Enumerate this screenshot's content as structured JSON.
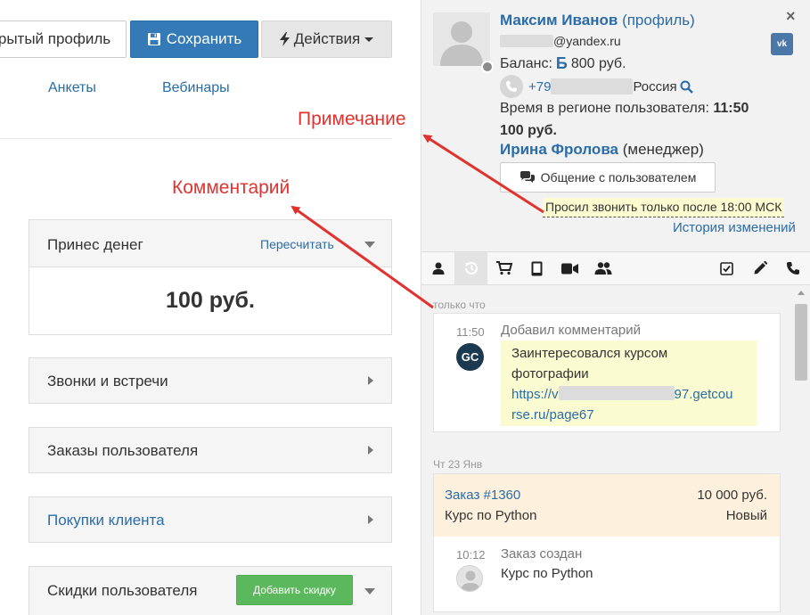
{
  "header": {
    "open_profile_label": "рытый профиль",
    "save_label": "Сохранить",
    "actions_label": "Действия"
  },
  "tabs": [
    "Анкеты",
    "Вебинары"
  ],
  "annotations": {
    "comment": "Комментарий",
    "note": "Примечание"
  },
  "panels": {
    "money": {
      "title": "Принес денег",
      "recalc": "Пересчитать",
      "amount": "100 руб."
    },
    "calls": {
      "title": "Звонки и встречи"
    },
    "orders": {
      "title": "Заказы пользователя"
    },
    "purchases": {
      "title": "Покупки клиента"
    },
    "discounts": {
      "title": "Скидки пользователя",
      "add_label": "Добавить скидку"
    }
  },
  "user": {
    "name": "Максим Иванов",
    "profile_link": "(профиль)",
    "email_domain": "@yandex.ru",
    "balance_label": "Баланс:",
    "balance_value": "800 руб.",
    "balance_icon": "Б",
    "phone_prefix": "+79",
    "phone_country": "Россия",
    "region_label": "Время в регионе пользователя:",
    "region_time": "11:50",
    "region_tail": "100 руб.",
    "manager_name": "Ирина Фролова",
    "manager_role": "(менеджер)",
    "chat_label": "Общение с пользователем",
    "note": "Просил звонить только после 18:00 МСК",
    "history_link": "История изменений",
    "vk_label": "vk",
    "close_glyph": "×"
  },
  "toolbar_icons": [
    "user-icon",
    "history-icon",
    "cart-icon",
    "tablet-icon",
    "video-icon",
    "group-icon",
    "checkbox-icon",
    "pencil-icon",
    "phone-icon"
  ],
  "feed": {
    "now_label": "только что",
    "comment": {
      "time": "11:50",
      "title": "Добавил комментарий",
      "text": "Заинтересовался курсом фотографии",
      "link_start": "https://v",
      "link_mid": "97.getcou",
      "link_end": "rse.ru/page67",
      "logo": "GC"
    },
    "date_label": "Чт 23 Янв",
    "order": {
      "number": "Заказ #1360",
      "sum": "10 000 руб.",
      "course": "Курс по Python",
      "status": "Новый",
      "event_time": "10:12",
      "event_title": "Заказ создан",
      "event_sub": "Курс по Python"
    }
  },
  "colors": {
    "link": "#2a6ca8",
    "primary_button": "#337ab7",
    "success_button": "#5cb85c",
    "annotation": "#e0332f",
    "note_bg": "#fdfbd0",
    "order_bg": "#fdf1dd"
  }
}
